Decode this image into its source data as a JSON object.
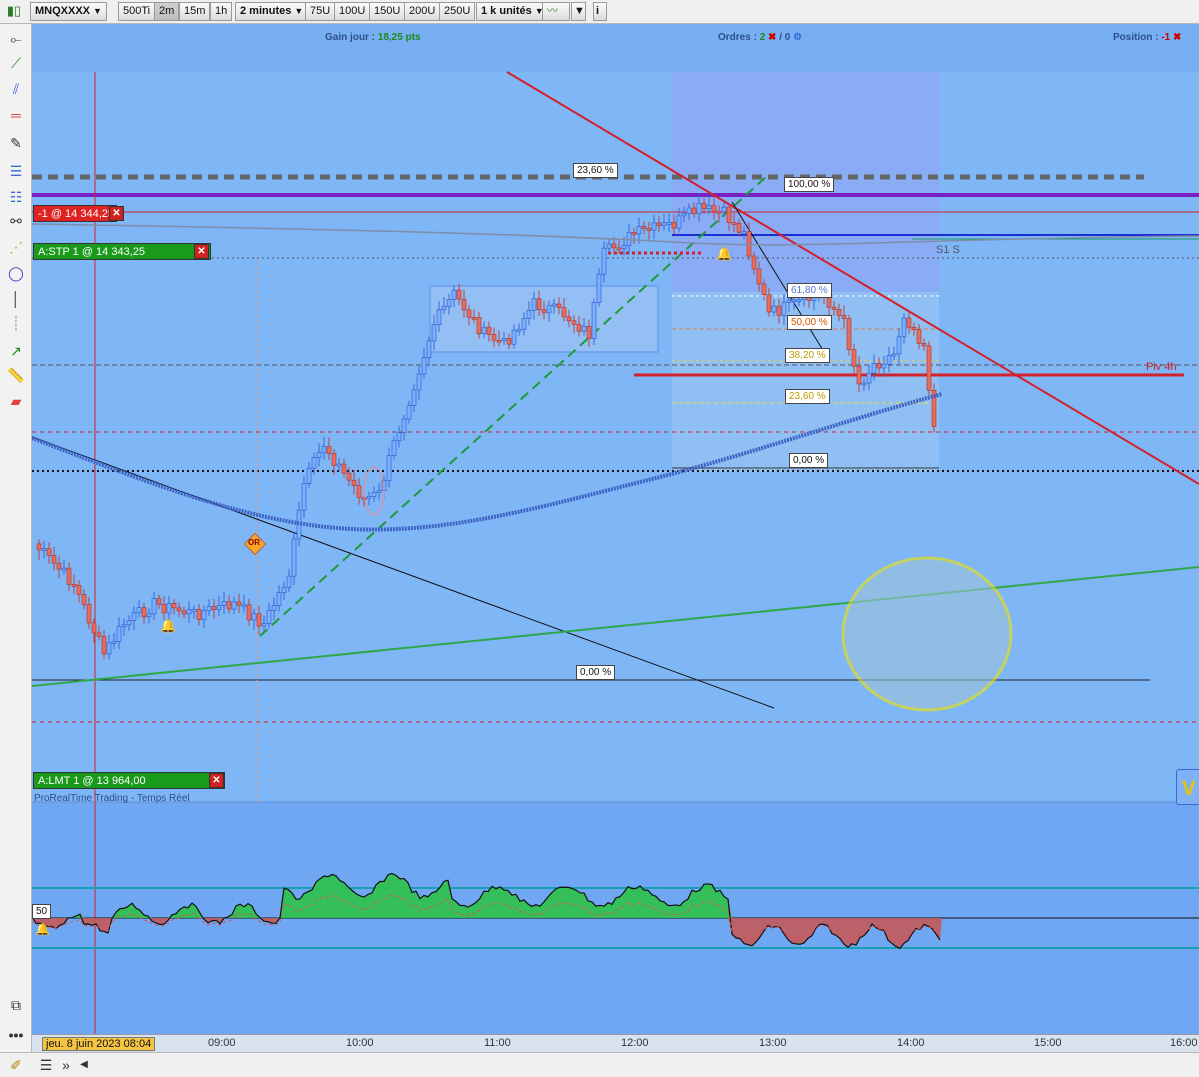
{
  "toolbar": {
    "symbol": "MNQXXXX",
    "buttons": [
      "500Ti",
      "2m",
      "15m",
      "1h"
    ],
    "active_button": "2m",
    "period": "2 minutes",
    "unit_buttons": [
      "75U",
      "100U",
      "150U",
      "200U",
      "250U"
    ],
    "quantity": "1 k unités",
    "info": "i"
  },
  "header": {
    "gain_label": "Gain jour :",
    "gain_value": "18,25 pts",
    "orders_label": "Ordres :",
    "orders_count": "2",
    "orders_sep": "/",
    "orders_other": "0",
    "position_label": "Position :",
    "position_value": "-1"
  },
  "orders": {
    "position_tag": "-1 @ 14 344,25",
    "stop_tag": "A:STP  1 @ 14 343,25",
    "limit_tag": "A:LMT  1 @ 13 964,00",
    "close": "✕"
  },
  "fib_labels": {
    "f100": "100,00 %",
    "f618": "61,80 %",
    "f50": "50,00 %",
    "f382": "38,20 %",
    "f236": "23,60 %",
    "f0": "0,00 %",
    "f236_left": "23,60 %",
    "f0_left": "0,00 %"
  },
  "chart_labels": {
    "s1": "S1 S",
    "pivot": "Piv 4h",
    "watermark": "ProRealTime Trading - Temps Réel",
    "osc_level": "50",
    "or_marker": "OR",
    "corner": "V"
  },
  "time_axis": {
    "date": "jeu. 8 juin 2023 08:04",
    "ticks": [
      "09:00",
      "10:00",
      "11:00",
      "12:00",
      "13:00",
      "14:00",
      "15:00",
      "16:00"
    ]
  },
  "colors": {
    "chart_bg": "#6fa7f2",
    "candle_up": "#7ab0ff",
    "candle_down": "#e86d5a",
    "ma": "#3b62c4",
    "resistance": "#d4202a",
    "fib_zone": "#8ea8f5",
    "oscillator_up": "#2ec24a",
    "oscillator_down": "#c35a5a"
  }
}
